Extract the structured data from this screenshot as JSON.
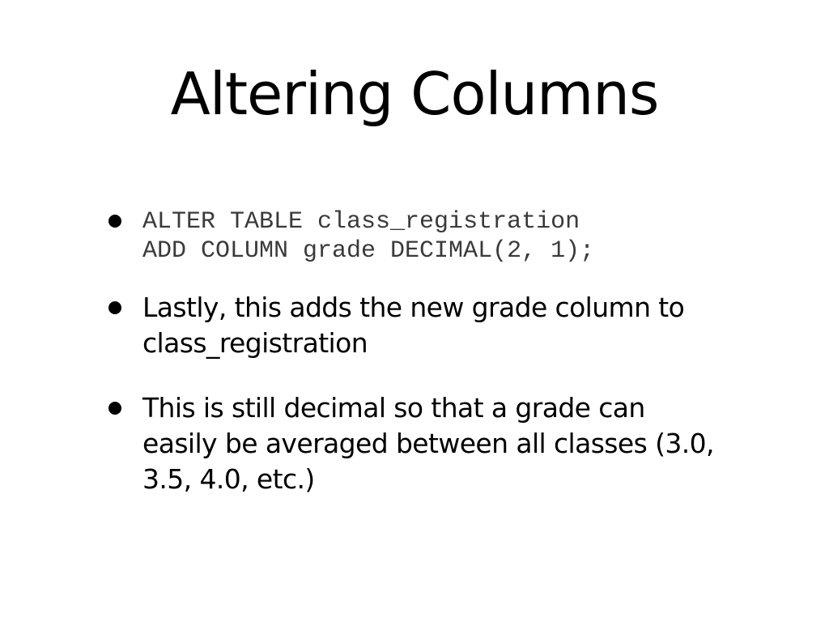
{
  "slide": {
    "title": "Altering Columns",
    "code_bullet": {
      "lines": [
        "ALTER TABLE class_registration",
        "ADD COLUMN grade DECIMAL(2, 1);"
      ]
    },
    "bullets": [
      {
        "lines": [
          "Lastly, this adds the new grade column to",
          "class_registration"
        ]
      },
      {
        "lines": [
          "This is still decimal so that a grade can",
          "easily be averaged between all classes (3.0,",
          "3.5, 4.0, etc.)"
        ]
      }
    ]
  }
}
